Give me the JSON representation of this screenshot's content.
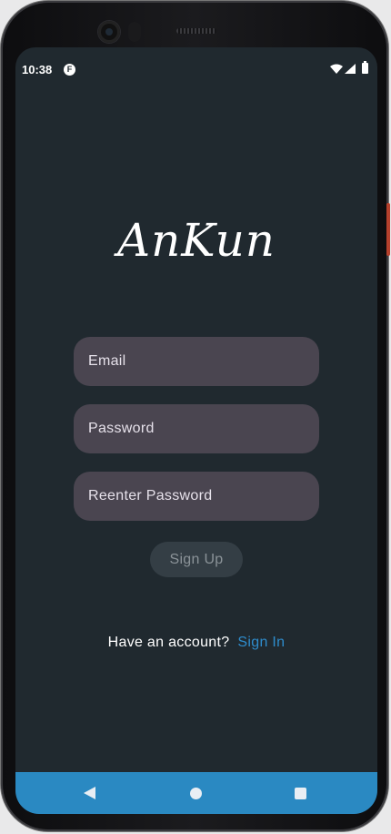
{
  "status_bar": {
    "time": "10:38",
    "notification_icon": "F"
  },
  "app": {
    "logo_text": "AnKun"
  },
  "form": {
    "email_placeholder": "Email",
    "password_placeholder": "Password",
    "reenter_placeholder": "Reenter Password",
    "signup_label": "Sign Up"
  },
  "footer": {
    "question": "Have an account?",
    "signin_label": "Sign In"
  },
  "nav": {
    "back_icon": "back-icon",
    "home_icon": "home-icon",
    "recent_icon": "recent-apps-icon"
  },
  "colors": {
    "background": "#20292f",
    "field": "#4a4550",
    "link": "#2e8ccc",
    "nav_bar": "#2a89c2"
  }
}
